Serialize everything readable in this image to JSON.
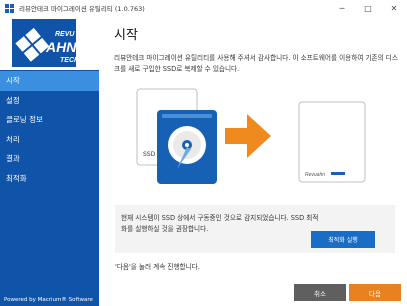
{
  "window": {
    "title": "리뷰안테크 마이그레이션 유틸리티 (1.0.763)",
    "icon": "app-grid-icon",
    "controls": {
      "minimize": "─",
      "maximize": "□",
      "close": "✕"
    }
  },
  "logo": {
    "text_line1": "REVU",
    "text_line2": "AHN",
    "text_line3": "TECH"
  },
  "sidebar": {
    "items": [
      {
        "label": "시작",
        "active": true
      },
      {
        "label": "설정",
        "active": false
      },
      {
        "label": "클로닝 정보",
        "active": false
      },
      {
        "label": "처리",
        "active": false
      },
      {
        "label": "결과",
        "active": false
      },
      {
        "label": "최적화",
        "active": false
      }
    ],
    "powered_by": "Powered by Macrium® Software"
  },
  "main": {
    "title": "시작",
    "intro": "리뷰안테크 마이그레이션 유틸리티를 사용해 주셔서 감사합니다. 이 소프트웨어를 이용하여 기존의 디스크를 새로 구입한 SSD로 복제할 수 있습니다.",
    "illustration": {
      "source_label": "SSD",
      "target_brand": "Revuahn"
    },
    "notice": {
      "text": "현재 시스템이 SSD 상에서 구동중인 것으로 감지되었습니다. SSD 최적화를 실행하실 것을 권장합니다.",
      "button": "최적화 실행"
    },
    "hint": "'다음'을 눌러 계속 진행합니다.",
    "buttons": {
      "cancel": "취소",
      "next": "다음"
    }
  },
  "colors": {
    "sidebar_bg": "#0f54a8",
    "sidebar_active": "#3b8fe0",
    "primary_button": "#1a6dc4",
    "next_button": "#e8821e",
    "cancel_button": "#5f5f5f",
    "arrow": "#ee8a1e"
  }
}
